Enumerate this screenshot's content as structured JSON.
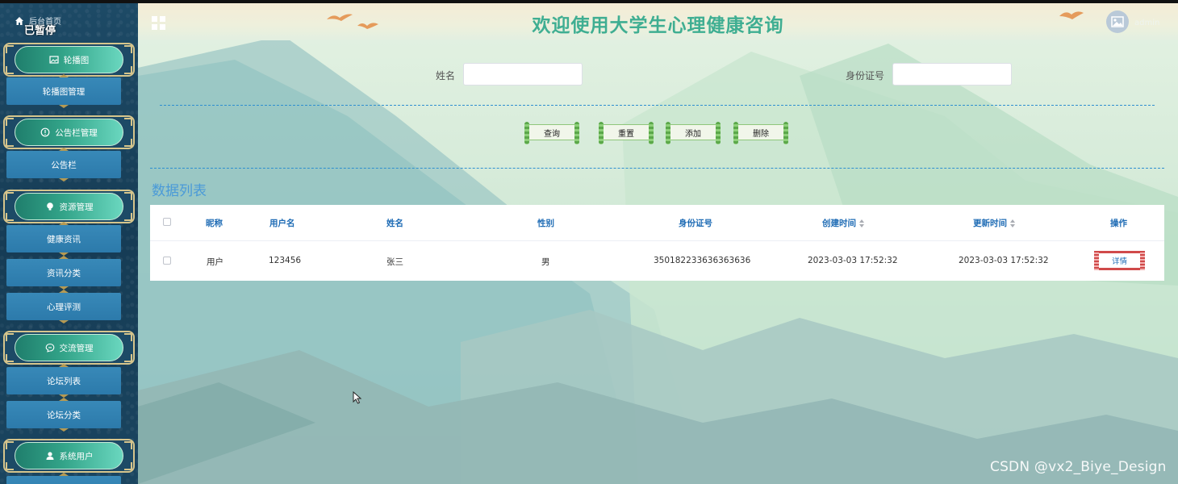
{
  "sidebar": {
    "home_label": "后台首页",
    "paused_label": "已暂停",
    "groups": [
      {
        "label": "轮播图",
        "icon": "image-icon",
        "items": [
          "轮播图管理"
        ]
      },
      {
        "label": "公告栏管理",
        "icon": "info-icon",
        "items": [
          "公告栏"
        ]
      },
      {
        "label": "资源管理",
        "icon": "bulb-icon",
        "items": [
          "健康资讯",
          "资讯分类",
          "心理评测"
        ]
      },
      {
        "label": "交流管理",
        "icon": "chat-icon",
        "items": [
          "论坛列表",
          "论坛分类"
        ]
      },
      {
        "label": "系统用户",
        "icon": "user-icon",
        "items": []
      }
    ]
  },
  "header": {
    "title": "欢迎使用大学生心理健康咨询",
    "username": "admin"
  },
  "search": {
    "name_label": "姓名",
    "name_value": "",
    "id_label": "身份证号",
    "id_value": ""
  },
  "actions": {
    "query": "查询",
    "reset": "重置",
    "add": "添加",
    "delete": "删除"
  },
  "list": {
    "title": "数据列表",
    "columns": [
      "昵称",
      "用户名",
      "姓名",
      "性别",
      "身份证号",
      "创建时间",
      "更新时间",
      "操作"
    ],
    "rows": [
      {
        "nickname": "用户",
        "username": "123456",
        "name": "张三",
        "gender": "男",
        "id_number": "350182233636363636",
        "created": "2023-03-03 17:52:32",
        "updated": "2023-03-03 17:52:32",
        "action": "详情"
      }
    ]
  },
  "watermark": "CSDN @vx2_Biye_Design",
  "colors": {
    "title": "#3fae92",
    "table_header": "#1f6cb5",
    "list_title": "#4a9ad8",
    "menu_item": "#2c7aab",
    "menu_group": "#33a489",
    "sidebar_bg": "#1d4a66"
  }
}
